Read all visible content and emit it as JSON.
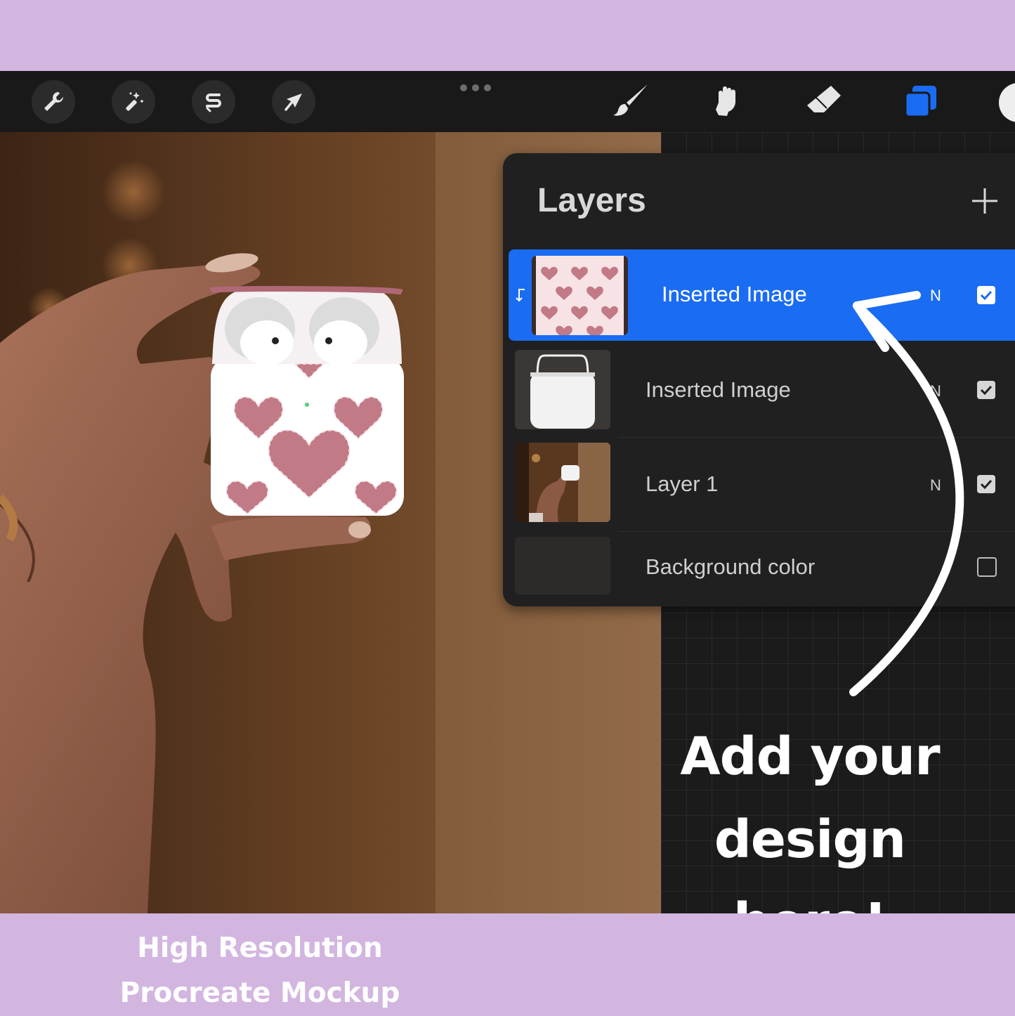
{
  "toolbar": {
    "left_tools": [
      "wrench-icon",
      "magic-wand-icon",
      "selection-s-icon",
      "transform-arrow-icon"
    ],
    "right_tools": [
      "brush-icon",
      "smudge-icon",
      "eraser-icon",
      "layers-icon"
    ],
    "accent_color": "#1a6cf2"
  },
  "layers": {
    "title": "Layers",
    "add_label": "+",
    "rows": [
      {
        "name": "Inserted Image",
        "blend": "N",
        "visible": true,
        "selected": true
      },
      {
        "name": "Inserted Image",
        "blend": "N",
        "visible": true,
        "selected": false
      },
      {
        "name": "Layer 1",
        "blend": "N",
        "visible": true,
        "selected": false
      },
      {
        "name": "Background color",
        "blend": "",
        "visible": false,
        "selected": false
      }
    ]
  },
  "callout": {
    "line1": "Add your",
    "line2": "design here!"
  },
  "footer": {
    "line1": "High Resolution",
    "line2": "Procreate Mockup"
  },
  "colors": {
    "band": "#d2b6e0",
    "toolbar": "#191919",
    "panel": "#202020",
    "heart": "#c27a86"
  }
}
